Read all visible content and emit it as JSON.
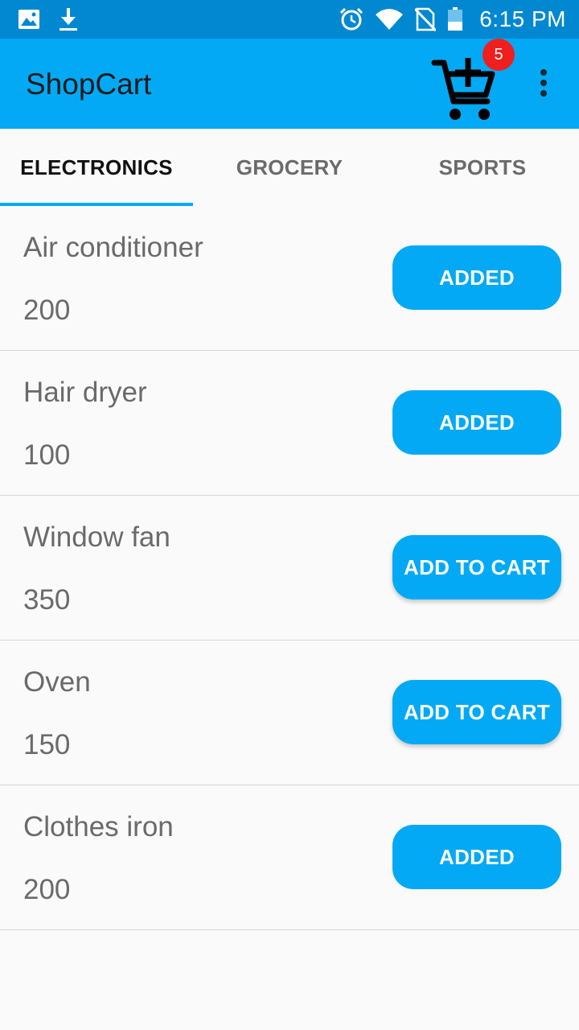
{
  "status_bar": {
    "time": "6:15 PM",
    "icons": [
      "image-icon",
      "download-icon",
      "alarm-icon",
      "wifi-icon",
      "no-sim-icon",
      "battery-icon"
    ]
  },
  "app_bar": {
    "title": "ShopCart",
    "cart_badge_count": "5",
    "cart_icon": "add-to-cart-icon",
    "menu_icon": "more-vert-icon"
  },
  "tabs": [
    {
      "label": "ELECTRONICS",
      "active": true
    },
    {
      "label": "GROCERY",
      "active": false
    },
    {
      "label": "SPORTS",
      "active": false
    }
  ],
  "items": [
    {
      "name": "Air conditioner",
      "price": "200",
      "button": "ADDED"
    },
    {
      "name": "Hair dryer",
      "price": "100",
      "button": "ADDED"
    },
    {
      "name": "Window fan",
      "price": "350",
      "button": "ADD TO CART"
    },
    {
      "name": "Oven",
      "price": "150",
      "button": "ADD TO CART"
    },
    {
      "name": "Clothes iron",
      "price": "200",
      "button": "ADDED"
    }
  ],
  "colors": {
    "status_bar": "#0288d1",
    "app_bar": "#03a9f4",
    "accent": "#03a9f4",
    "badge": "#f01f1f"
  }
}
